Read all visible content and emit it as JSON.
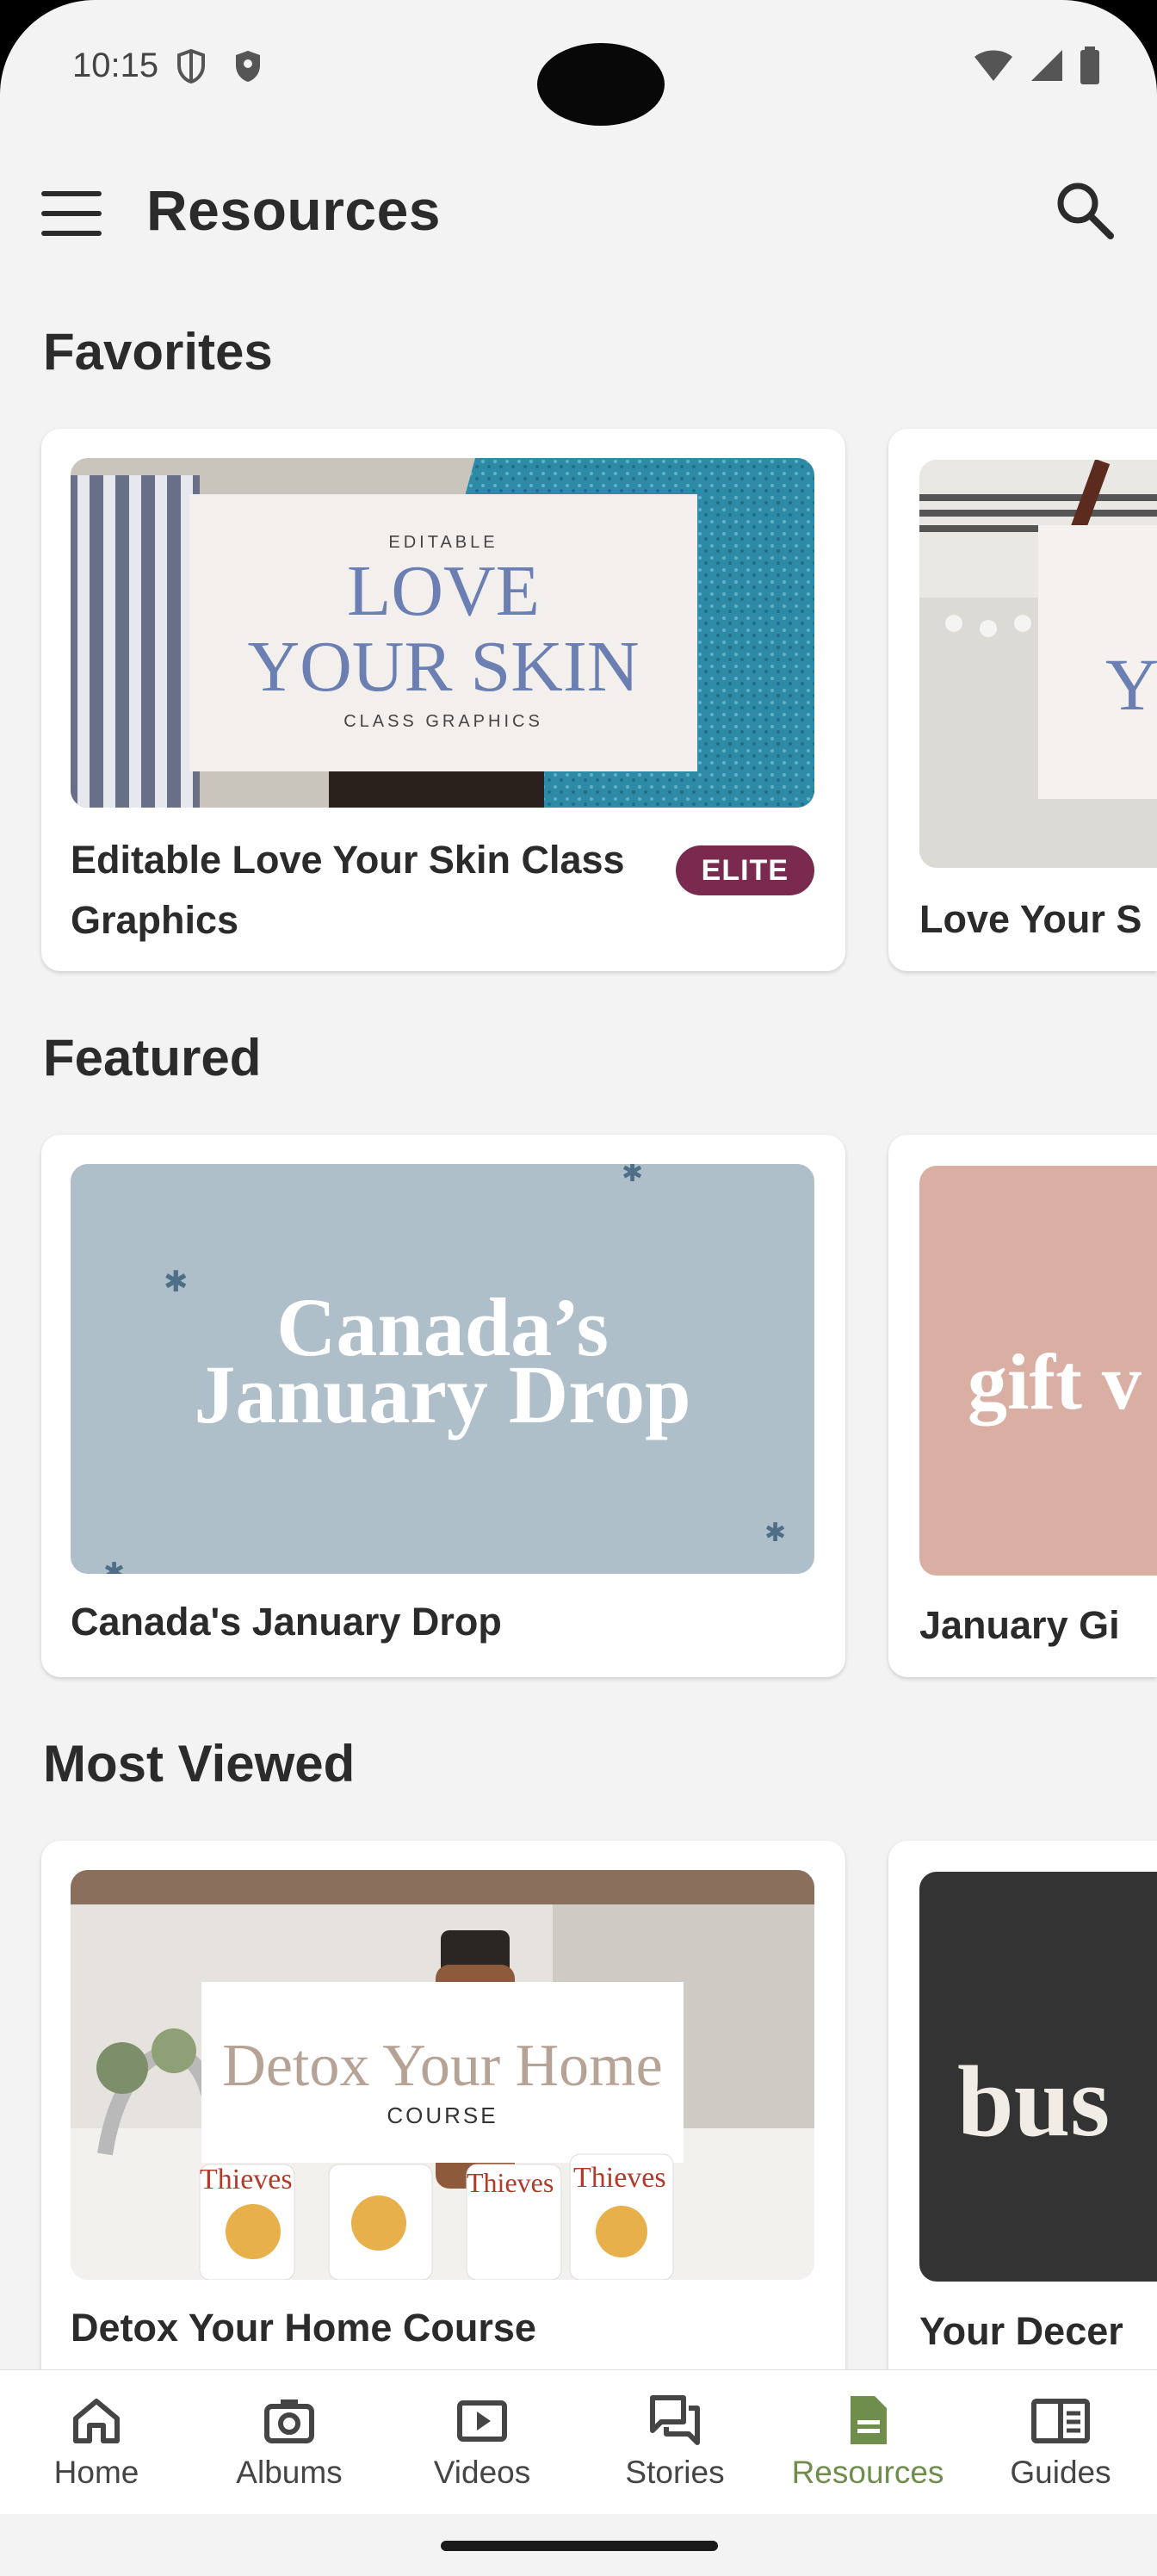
{
  "status_bar": {
    "time": "10:15"
  },
  "app_bar": {
    "title": "Resources"
  },
  "sections": [
    {
      "title": "Favorites",
      "cards": [
        {
          "title": "Editable Love Your Skin Class Graphics",
          "badge": "ELITE",
          "image_text": {
            "top": "EDITABLE",
            "main_line1": "LOVE",
            "main_line2": "YOUR SKIN",
            "bottom": "CLASS GRAPHICS"
          }
        },
        {
          "title": "Love Your S",
          "image_text": {
            "fragment": "Y"
          }
        }
      ]
    },
    {
      "title": "Featured",
      "cards": [
        {
          "title": "Canada's January Drop",
          "image_text": {
            "line1": "Canada’s",
            "line2": "January Drop"
          }
        },
        {
          "title": "January Gi",
          "image_text": {
            "fragment": "gift v"
          }
        }
      ]
    },
    {
      "title": "Most Viewed",
      "cards": [
        {
          "title": "Detox Your Home Course",
          "image_text": {
            "main": "Detox Your Home",
            "sub": "COURSE",
            "bottle1": "Thieves",
            "bottle2": "Thieves",
            "bottle3": "Thieves"
          }
        },
        {
          "title": "Your Decer",
          "image_text": {
            "fragment": "bus"
          }
        }
      ]
    }
  ],
  "bottom_nav": [
    {
      "label": "Home",
      "icon": "home-icon"
    },
    {
      "label": "Albums",
      "icon": "camera-icon"
    },
    {
      "label": "Videos",
      "icon": "play-icon"
    },
    {
      "label": "Stories",
      "icon": "chat-icon"
    },
    {
      "label": "Resources",
      "icon": "document-icon",
      "active": true
    },
    {
      "label": "Guides",
      "icon": "book-icon"
    }
  ],
  "colors": {
    "accent": "#6f8e4b",
    "badge": "#7a2a4e",
    "background": "#f3f3f3"
  }
}
